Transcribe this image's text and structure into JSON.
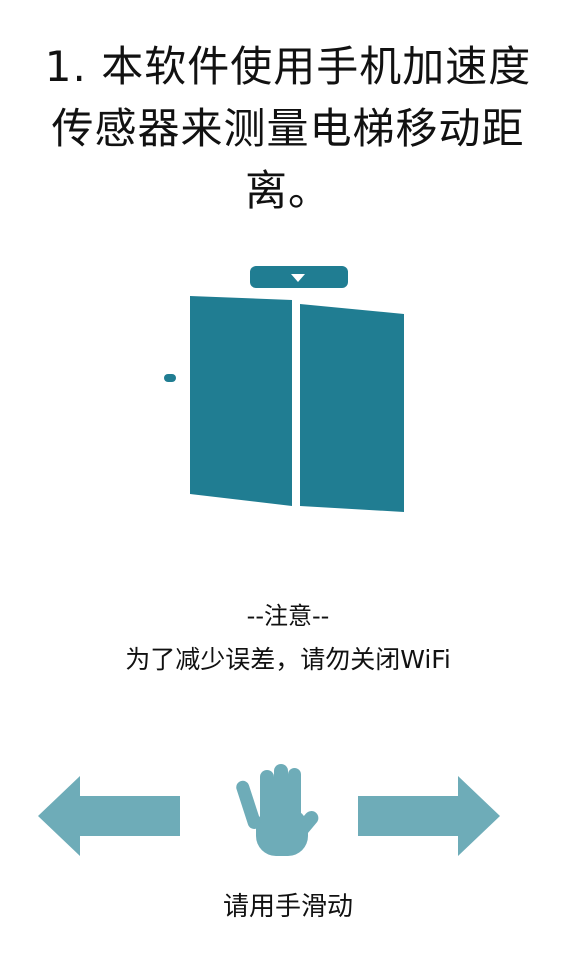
{
  "intro": {
    "step_text": "1. 本软件使用手机加速度传感器来测量电梯移动距离。"
  },
  "notice": {
    "heading": "--注意--",
    "message": "为了减少误差，请勿关闭WiFi"
  },
  "swipe": {
    "hint": "请用手滑动",
    "left_icon": "arrow-left-icon",
    "right_icon": "arrow-right-icon",
    "hand_icon": "hand-icon"
  },
  "colors": {
    "elevator_door": "#207d92",
    "arrow": "#6eacb8",
    "hand": "#6eacb8"
  }
}
